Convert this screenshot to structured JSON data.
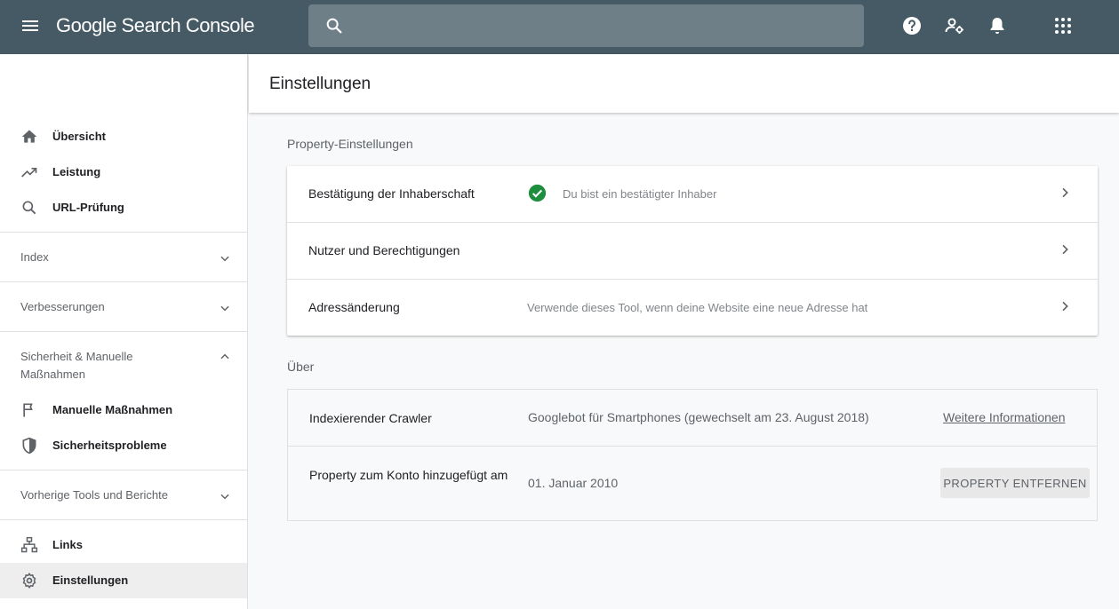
{
  "app": {
    "title": "Google Search Console"
  },
  "search": {
    "value": "",
    "placeholder": ""
  },
  "topbar_icons": [
    "menu-icon",
    "search-icon",
    "help-icon",
    "user-settings-icon",
    "bell-icon",
    "apps-grid-icon"
  ],
  "sidebar": {
    "top_items": [
      {
        "label": "Übersicht",
        "icon": "home-icon"
      },
      {
        "label": "Leistung",
        "icon": "trending-up-icon"
      },
      {
        "label": "URL-Prüfung",
        "icon": "search-icon"
      }
    ],
    "sections": {
      "index": {
        "label": "Index",
        "state": "collapsed"
      },
      "improvements": {
        "label": "Verbesserungen",
        "state": "collapsed"
      },
      "security": {
        "label": "Sicherheit & Manuelle Maßnahmen",
        "state": "expanded",
        "items": [
          {
            "label": "Manuelle Maßnahmen",
            "icon": "flag-icon"
          },
          {
            "label": "Sicherheitsprobleme",
            "icon": "shield-icon"
          }
        ]
      },
      "legacy": {
        "label": "Vorherige Tools und Berichte",
        "state": "collapsed"
      }
    },
    "bottom_items": [
      {
        "label": "Links",
        "icon": "sitemap-icon"
      },
      {
        "label": "Einstellungen",
        "icon": "gear-icon",
        "active": true
      }
    ]
  },
  "main": {
    "title": "Einstellungen",
    "property_settings": {
      "heading": "Property-Einstellungen",
      "rows": [
        {
          "title": "Bestätigung der Inhaberschaft",
          "status": "Du bist ein bestätigter Inhaber",
          "status_icon": "check-circle-icon"
        },
        {
          "title": "Nutzer und Berechtigungen",
          "status": ""
        },
        {
          "title": "Adressänderung",
          "status": "Verwende dieses Tool, wenn deine Website eine neue Adresse hat"
        }
      ]
    },
    "about": {
      "heading": "Über",
      "crawler": {
        "title": "Indexierender Crawler",
        "value": "Googlebot für Smartphones (gewechselt am 23. August 2018)",
        "link": "Weitere Informationen"
      },
      "added": {
        "title": "Property zum Konto hinzugefügt am",
        "value": "01. Januar 2010",
        "button": "PROPERTY ENTFERNEN"
      }
    }
  },
  "colors": {
    "topbar": "#455a64",
    "search_bg": "#6e7f87",
    "success_green": "#1e8e3e",
    "active_nav_bg": "#eeeeee",
    "page_bg": "#f8f9fa"
  }
}
